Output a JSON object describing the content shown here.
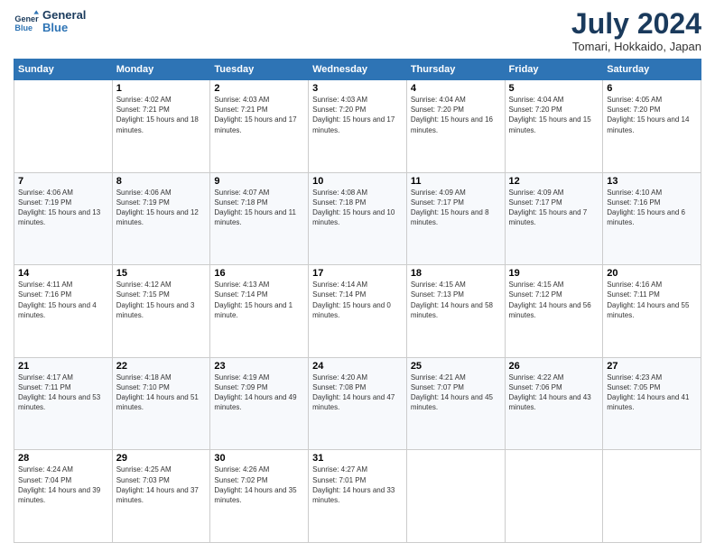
{
  "header": {
    "logo_line1": "General",
    "logo_line2": "Blue",
    "month_title": "July 2024",
    "location": "Tomari, Hokkaido, Japan"
  },
  "weekdays": [
    "Sunday",
    "Monday",
    "Tuesday",
    "Wednesday",
    "Thursday",
    "Friday",
    "Saturday"
  ],
  "weeks": [
    [
      {
        "day": "",
        "sunrise": "",
        "sunset": "",
        "daylight": ""
      },
      {
        "day": "1",
        "sunrise": "4:02 AM",
        "sunset": "7:21 PM",
        "daylight": "15 hours and 18 minutes."
      },
      {
        "day": "2",
        "sunrise": "4:03 AM",
        "sunset": "7:21 PM",
        "daylight": "15 hours and 17 minutes."
      },
      {
        "day": "3",
        "sunrise": "4:03 AM",
        "sunset": "7:20 PM",
        "daylight": "15 hours and 17 minutes."
      },
      {
        "day": "4",
        "sunrise": "4:04 AM",
        "sunset": "7:20 PM",
        "daylight": "15 hours and 16 minutes."
      },
      {
        "day": "5",
        "sunrise": "4:04 AM",
        "sunset": "7:20 PM",
        "daylight": "15 hours and 15 minutes."
      },
      {
        "day": "6",
        "sunrise": "4:05 AM",
        "sunset": "7:20 PM",
        "daylight": "15 hours and 14 minutes."
      }
    ],
    [
      {
        "day": "7",
        "sunrise": "4:06 AM",
        "sunset": "7:19 PM",
        "daylight": "15 hours and 13 minutes."
      },
      {
        "day": "8",
        "sunrise": "4:06 AM",
        "sunset": "7:19 PM",
        "daylight": "15 hours and 12 minutes."
      },
      {
        "day": "9",
        "sunrise": "4:07 AM",
        "sunset": "7:18 PM",
        "daylight": "15 hours and 11 minutes."
      },
      {
        "day": "10",
        "sunrise": "4:08 AM",
        "sunset": "7:18 PM",
        "daylight": "15 hours and 10 minutes."
      },
      {
        "day": "11",
        "sunrise": "4:09 AM",
        "sunset": "7:17 PM",
        "daylight": "15 hours and 8 minutes."
      },
      {
        "day": "12",
        "sunrise": "4:09 AM",
        "sunset": "7:17 PM",
        "daylight": "15 hours and 7 minutes."
      },
      {
        "day": "13",
        "sunrise": "4:10 AM",
        "sunset": "7:16 PM",
        "daylight": "15 hours and 6 minutes."
      }
    ],
    [
      {
        "day": "14",
        "sunrise": "4:11 AM",
        "sunset": "7:16 PM",
        "daylight": "15 hours and 4 minutes."
      },
      {
        "day": "15",
        "sunrise": "4:12 AM",
        "sunset": "7:15 PM",
        "daylight": "15 hours and 3 minutes."
      },
      {
        "day": "16",
        "sunrise": "4:13 AM",
        "sunset": "7:14 PM",
        "daylight": "15 hours and 1 minute."
      },
      {
        "day": "17",
        "sunrise": "4:14 AM",
        "sunset": "7:14 PM",
        "daylight": "15 hours and 0 minutes."
      },
      {
        "day": "18",
        "sunrise": "4:15 AM",
        "sunset": "7:13 PM",
        "daylight": "14 hours and 58 minutes."
      },
      {
        "day": "19",
        "sunrise": "4:15 AM",
        "sunset": "7:12 PM",
        "daylight": "14 hours and 56 minutes."
      },
      {
        "day": "20",
        "sunrise": "4:16 AM",
        "sunset": "7:11 PM",
        "daylight": "14 hours and 55 minutes."
      }
    ],
    [
      {
        "day": "21",
        "sunrise": "4:17 AM",
        "sunset": "7:11 PM",
        "daylight": "14 hours and 53 minutes."
      },
      {
        "day": "22",
        "sunrise": "4:18 AM",
        "sunset": "7:10 PM",
        "daylight": "14 hours and 51 minutes."
      },
      {
        "day": "23",
        "sunrise": "4:19 AM",
        "sunset": "7:09 PM",
        "daylight": "14 hours and 49 minutes."
      },
      {
        "day": "24",
        "sunrise": "4:20 AM",
        "sunset": "7:08 PM",
        "daylight": "14 hours and 47 minutes."
      },
      {
        "day": "25",
        "sunrise": "4:21 AM",
        "sunset": "7:07 PM",
        "daylight": "14 hours and 45 minutes."
      },
      {
        "day": "26",
        "sunrise": "4:22 AM",
        "sunset": "7:06 PM",
        "daylight": "14 hours and 43 minutes."
      },
      {
        "day": "27",
        "sunrise": "4:23 AM",
        "sunset": "7:05 PM",
        "daylight": "14 hours and 41 minutes."
      }
    ],
    [
      {
        "day": "28",
        "sunrise": "4:24 AM",
        "sunset": "7:04 PM",
        "daylight": "14 hours and 39 minutes."
      },
      {
        "day": "29",
        "sunrise": "4:25 AM",
        "sunset": "7:03 PM",
        "daylight": "14 hours and 37 minutes."
      },
      {
        "day": "30",
        "sunrise": "4:26 AM",
        "sunset": "7:02 PM",
        "daylight": "14 hours and 35 minutes."
      },
      {
        "day": "31",
        "sunrise": "4:27 AM",
        "sunset": "7:01 PM",
        "daylight": "14 hours and 33 minutes."
      },
      {
        "day": "",
        "sunrise": "",
        "sunset": "",
        "daylight": ""
      },
      {
        "day": "",
        "sunrise": "",
        "sunset": "",
        "daylight": ""
      },
      {
        "day": "",
        "sunrise": "",
        "sunset": "",
        "daylight": ""
      }
    ]
  ],
  "labels": {
    "sunrise_prefix": "Sunrise: ",
    "sunset_prefix": "Sunset: ",
    "daylight_prefix": "Daylight: "
  }
}
